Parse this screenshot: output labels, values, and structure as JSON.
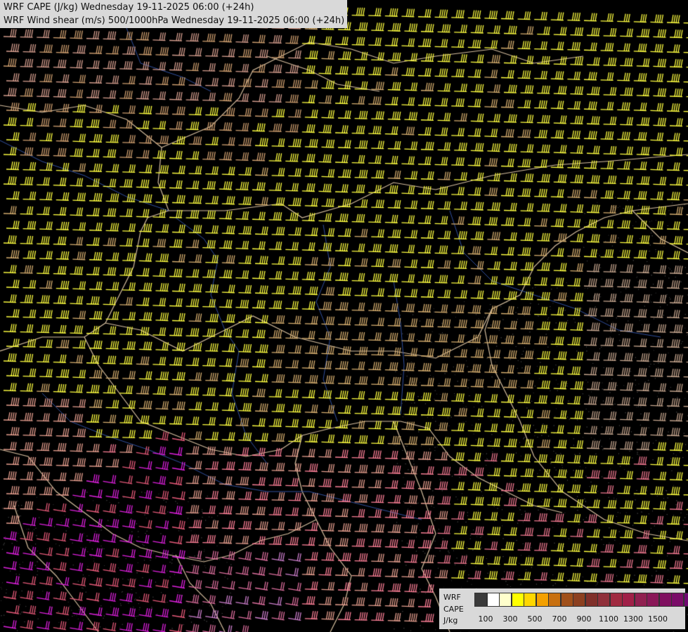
{
  "header": {
    "line1": "WRF CAPE (J/kg) Wednesday 19-11-2025 06:00 (+24h)",
    "line2": "WRF Wind shear (m/s) 500/1000hPa Wednesday 19-11-2025 06:00 (+24h)"
  },
  "legend": {
    "labels": [
      "WRF",
      "CAPE",
      "J/kg"
    ],
    "swatch_colors": [
      "#3a3a3a",
      "#ffffff",
      "#ffffcc",
      "#ffff00",
      "#ffd700",
      "#f4a000",
      "#c87010",
      "#a0501a",
      "#8c4020",
      "#80302a",
      "#90303a",
      "#a02a40",
      "#a02048",
      "#902050",
      "#8a1858",
      "#801060",
      "#7a0c68",
      "#700870",
      "#660078"
    ],
    "ticks": [
      "100",
      "300",
      "500",
      "700",
      "900",
      "1100",
      "1300",
      "1500"
    ]
  },
  "map": {
    "barb_colors": [
      "#ffff40",
      "#e8c070",
      "#e8a090",
      "#ff80a0",
      "#e020e0",
      "#c080c0",
      "#ffb0ff"
    ]
  }
}
